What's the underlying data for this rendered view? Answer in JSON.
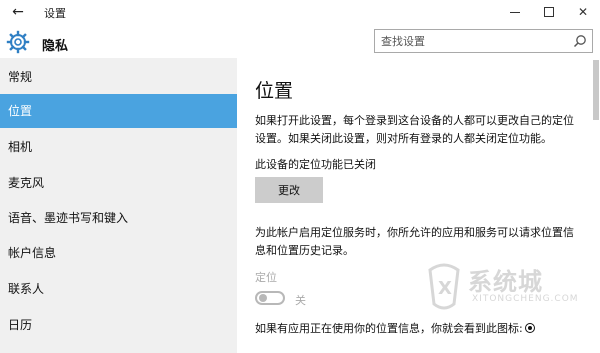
{
  "window": {
    "title": "设置",
    "back_glyph": "←",
    "close_glyph": "✕"
  },
  "header": {
    "title": "隐私",
    "search_placeholder": "查找设置"
  },
  "sidebar": {
    "items": [
      {
        "label": "常规"
      },
      {
        "label": "位置"
      },
      {
        "label": "相机"
      },
      {
        "label": "麦克风"
      },
      {
        "label": "语音、墨迹书写和键入"
      },
      {
        "label": "帐户信息"
      },
      {
        "label": "联系人"
      },
      {
        "label": "日历"
      }
    ],
    "active_index": 1
  },
  "main": {
    "title": "位置",
    "intro_line1": "如果打开此设置，每个登录到这台设备的人都可以更改自己的定位",
    "intro_line2": "设置。如果关闭此设置，则对所有登录的人都关闭定位功能。",
    "device_status": "此设备的定位功能已关闭",
    "change_button": "更改",
    "account_line1": "为此帐户启用定位服务时，你所允许的应用和服务可以请求位置信",
    "account_line2": "息和位置历史记录。",
    "location_label": "定位",
    "toggle_state_text": "关",
    "toggle_on": false,
    "icon_note": "如果有应用正在使用你的位置信息，你就会看到此图标:"
  },
  "watermark": {
    "text": "系统城",
    "sub": "XITONGCHENG.COM"
  },
  "colors": {
    "accent": "#4aa3e0",
    "sidebar_bg": "#f0f0f0",
    "button_bg": "#cccccc",
    "disabled_text": "#aaaaaa"
  },
  "icons": [
    "back-icon",
    "minimize-icon",
    "maximize-icon",
    "close-icon",
    "gear-icon",
    "search-icon",
    "location-radio-icon"
  ]
}
